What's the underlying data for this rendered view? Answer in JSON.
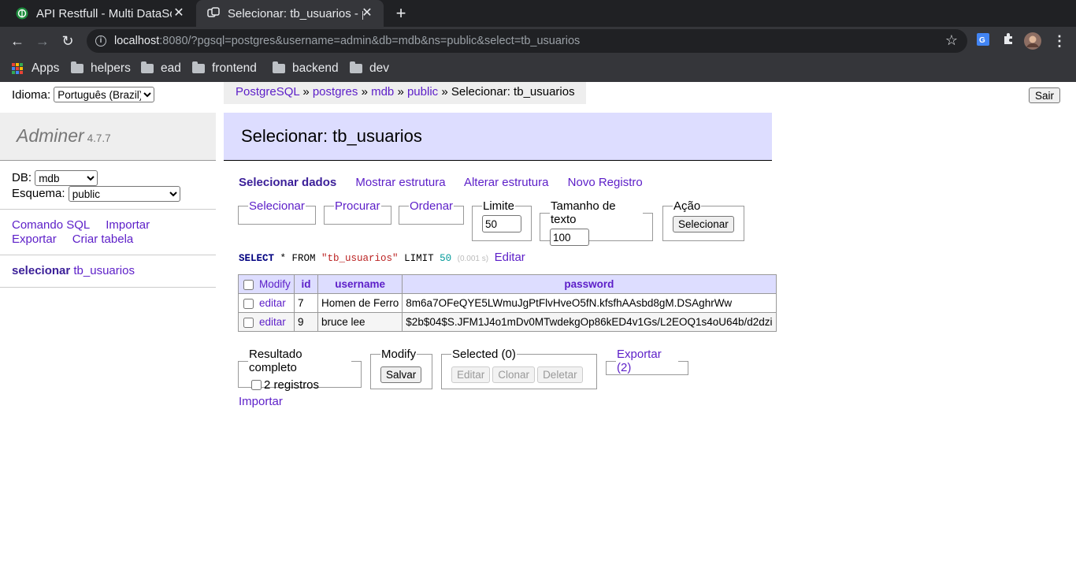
{
  "browser": {
    "tabs": [
      {
        "title": "API Restfull - Multi DataSource",
        "active": false
      },
      {
        "title": "Selecionar: tb_usuarios - postgres",
        "active": true
      }
    ],
    "url_host": "localhost",
    "url_rest": ":8080/?pgsql=postgres&username=admin&db=mdb&ns=public&select=tb_usuarios",
    "bookmarks": [
      "Apps",
      "helpers",
      "ead",
      "frontend",
      "backend",
      "dev"
    ]
  },
  "lang": {
    "label": "Idioma:",
    "selected": "Português (Brazil)"
  },
  "menu": {
    "app_name": "Adminer",
    "version": "4.7.7",
    "db_label": "DB:",
    "db_value": "mdb",
    "schema_label": "Esquema:",
    "schema_value": "public",
    "links": [
      "Comando SQL",
      "Importar",
      "Exportar",
      "Criar tabela"
    ],
    "table_action": "selecionar",
    "table_name": "tb_usuarios"
  },
  "breadcrumb": {
    "items": [
      "PostgreSQL",
      "postgres",
      "mdb",
      "public"
    ],
    "separator": "»",
    "current": "Selecionar: tb_usuarios"
  },
  "logout_label": "Sair",
  "page_title": "Selecionar: tb_usuarios",
  "subnav": [
    "Selecionar dados",
    "Mostrar estrutura",
    "Alterar estrutura",
    "Novo Registro"
  ],
  "filters": {
    "select": "Selecionar",
    "search": "Procurar",
    "order": "Ordenar",
    "limit_label": "Limite",
    "limit_value": "50",
    "textlen_label": "Tamanho de texto",
    "textlen_value": "100",
    "action_label": "Ação",
    "action_button": "Selecionar"
  },
  "query": {
    "kw_select": "SELECT",
    "star_from": " * FROM ",
    "table": "\"tb_usuarios\"",
    "kw_limit": " LIMIT ",
    "limit": "50",
    "time": "(0.001 s)",
    "edit": "Editar"
  },
  "table": {
    "columns": [
      "Modify",
      "id",
      "username",
      "password"
    ],
    "rows": [
      {
        "action": "editar",
        "id": "7",
        "username": "Homen de Ferro",
        "password": "8m6a7OFeQYE5LWmuJgPtFlvHveO5fN.kfsfhAAsbd8gM.DSAghrWw"
      },
      {
        "action": "editar",
        "id": "9",
        "username": "bruce lee",
        "password": "$2b$04$S.JFM1J4o1mDv0MTwdekgOp86kED4v1Gs/L2EOQ1s4oU64b/d2dzi"
      }
    ]
  },
  "bottom": {
    "result_legend": "Resultado completo",
    "result_count": "2 registros",
    "modify_legend": "Modify",
    "save_button": "Salvar",
    "selected_legend": "Selected (0)",
    "edit_button": "Editar",
    "clone_button": "Clonar",
    "delete_button": "Deletar",
    "export_legend": "Exportar (2)",
    "import_link": "Importar"
  }
}
